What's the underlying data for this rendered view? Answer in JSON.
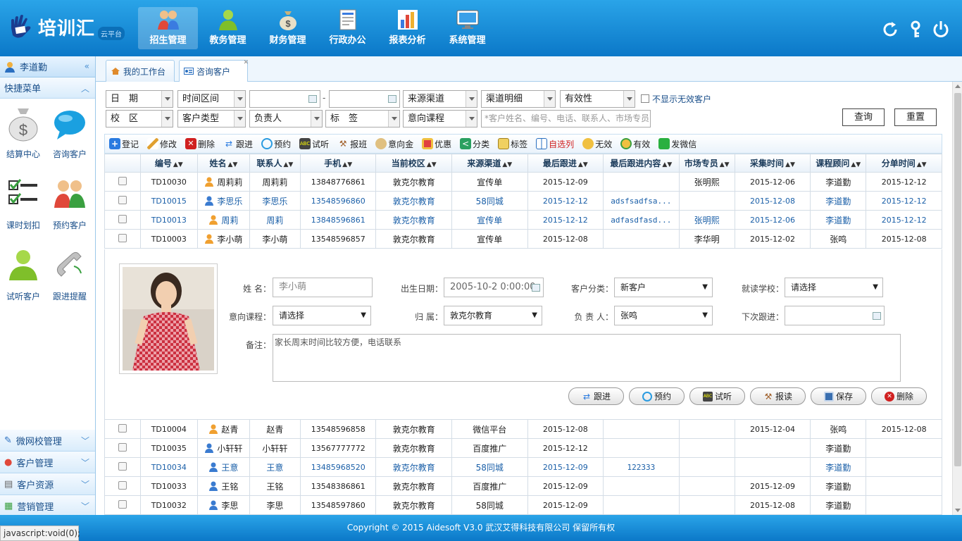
{
  "brand": {
    "name": "培训汇",
    "badge": "云平台"
  },
  "nav": [
    {
      "label": "招生管理",
      "active": true
    },
    {
      "label": "教务管理"
    },
    {
      "label": "财务管理"
    },
    {
      "label": "行政办公"
    },
    {
      "label": "报表分析"
    },
    {
      "label": "系统管理"
    }
  ],
  "sidebar": {
    "user": "李道勤",
    "quick_title": "快捷菜单",
    "quick_items": [
      "结算中心",
      "咨询客户",
      "课时划扣",
      "预约客户",
      "试听客户",
      "跟进提醒"
    ],
    "sections": [
      "微网校管理",
      "客户管理",
      "客户资源",
      "营销管理"
    ]
  },
  "tabs": [
    "我的工作台",
    "咨询客户"
  ],
  "filters": {
    "date": "日　期",
    "range": "时间区间",
    "sep": "-",
    "source": "来源渠道",
    "source_detail": "渠道明细",
    "validity": "有效性",
    "hide_invalid": "不显示无效客户",
    "campus": "校　区",
    "type": "客户类型",
    "owner": "负责人",
    "tag": "标　签",
    "course": "意向课程",
    "search_placeholder": "*客户姓名、编号、电话、联系人、市场专员",
    "query": "查询",
    "reset": "重置"
  },
  "toolbar": [
    "登记",
    "修改",
    "删除",
    "跟进",
    "预约",
    "试听",
    "报班",
    "意向金",
    "优惠",
    "分类",
    "标签",
    "自选列",
    "无效",
    "有效",
    "发微信"
  ],
  "table": {
    "headers": [
      "编号",
      "姓名",
      "联系人",
      "手机",
      "当前校区",
      "来源渠道",
      "最后跟进",
      "最后跟进内容",
      "市场专员",
      "采集时间",
      "课程顾问",
      "分单时间"
    ],
    "rows_top": [
      {
        "id": "TD10030",
        "name": "周莉莉",
        "contact": "周莉莉",
        "phone": "13848776861",
        "campus": "敦克尔教育",
        "source": "宣传单",
        "last": "2015-12-09",
        "content": "",
        "market": "张明熙",
        "collect": "2015-12-06",
        "advisor": "李道勤",
        "assign": "2015-12-12",
        "blue": false,
        "female": true
      },
      {
        "id": "TD10015",
        "name": "李思乐",
        "contact": "李思乐",
        "phone": "13548596860",
        "campus": "敦克尔教育",
        "source": "58同城",
        "last": "2015-12-12",
        "content": "adsfsadfsa...",
        "market": "",
        "collect": "2015-12-08",
        "advisor": "李道勤",
        "assign": "2015-12-12",
        "blue": true,
        "female": false
      },
      {
        "id": "TD10013",
        "name": "周莉",
        "contact": "周莉",
        "phone": "13848596861",
        "campus": "敦克尔教育",
        "source": "宣传单",
        "last": "2015-12-12",
        "content": "adfasdfasd...",
        "market": "张明熙",
        "collect": "2015-12-06",
        "advisor": "李道勤",
        "assign": "2015-12-12",
        "blue": true,
        "female": true
      },
      {
        "id": "TD10003",
        "name": "李小萌",
        "contact": "李小萌",
        "phone": "13548596857",
        "campus": "敦克尔教育",
        "source": "宣传单",
        "last": "2015-12-08",
        "content": "",
        "market": "李华明",
        "collect": "2015-12-02",
        "advisor": "张鸣",
        "assign": "2015-12-08",
        "blue": false,
        "female": true
      }
    ],
    "rows_bottom": [
      {
        "id": "TD10004",
        "name": "赵青",
        "contact": "赵青",
        "phone": "13548596858",
        "campus": "敦克尔教育",
        "source": "微信平台",
        "last": "2015-12-08",
        "content": "",
        "market": "",
        "collect": "2015-12-04",
        "advisor": "张鸣",
        "assign": "2015-12-08",
        "blue": false,
        "female": true
      },
      {
        "id": "TD10035",
        "name": "小轩轩",
        "contact": "小轩轩",
        "phone": "13567777772",
        "campus": "敦克尔教育",
        "source": "百度推广",
        "last": "2015-12-12",
        "content": "",
        "market": "",
        "collect": "",
        "advisor": "李道勤",
        "assign": "",
        "blue": false,
        "female": false
      },
      {
        "id": "TD10034",
        "name": "王意",
        "contact": "王意",
        "phone": "13485968520",
        "campus": "敦克尔教育",
        "source": "58同城",
        "last": "2015-12-09",
        "content": "122333",
        "market": "",
        "collect": "",
        "advisor": "李道勤",
        "assign": "",
        "blue": true,
        "female": false
      },
      {
        "id": "TD10033",
        "name": "王铭",
        "contact": "王铭",
        "phone": "13548386861",
        "campus": "敦克尔教育",
        "source": "百度推广",
        "last": "2015-12-09",
        "content": "",
        "market": "",
        "collect": "2015-12-09",
        "advisor": "李道勤",
        "assign": "",
        "blue": false,
        "female": false
      },
      {
        "id": "TD10032",
        "name": "李思",
        "contact": "李思",
        "phone": "13548597860",
        "campus": "敦克尔教育",
        "source": "58同城",
        "last": "2015-12-09",
        "content": "",
        "market": "",
        "collect": "2015-12-08",
        "advisor": "李道勤",
        "assign": "",
        "blue": false,
        "female": false
      }
    ]
  },
  "detail": {
    "name_label": "姓 名：",
    "name_value": "李小萌",
    "birth_label": "出生日期：",
    "birth_value": "2005-10-2 0:00:00",
    "cat_label": "客户分类：",
    "cat_value": "新客户",
    "school_label": "就读学校：",
    "school_value": "请选择",
    "course_label": "意向课程：",
    "course_value": "请选择",
    "belong_label": "归 属：",
    "belong_value": "敦克尔教育",
    "owner_label": "负 责 人：",
    "owner_value": "张鸣",
    "next_label": "下次跟进：",
    "next_value": "",
    "remark_label": "备注：",
    "remark_value": "家长周末时间比较方便，电话联系",
    "buttons": [
      "跟进",
      "预约",
      "试听",
      "报读",
      "保存",
      "删除"
    ]
  },
  "footer": "Copyright © 2015 Aidesoft V3.0 武汉艾得科技有限公司 保留所有权",
  "statusbar": "javascript:void(0);",
  "colors": {
    "header": "#1a8fdc",
    "accent": "#0b78c8"
  }
}
